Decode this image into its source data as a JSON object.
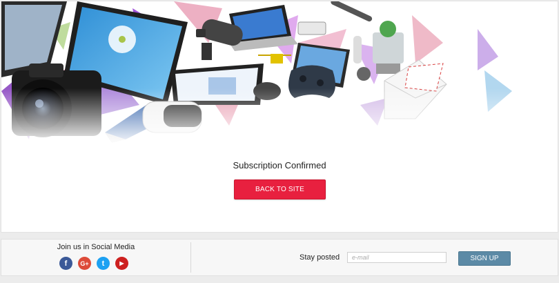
{
  "main": {
    "confirmation_text": "Subscription Confirmed",
    "back_button_label": "BACK TO SITE",
    "accent_color": "#e8203f"
  },
  "footer": {
    "social_title": "Join us in Social Media",
    "social_icons": [
      {
        "name": "facebook-icon",
        "glyph": "f",
        "color": "#3b5998"
      },
      {
        "name": "google-plus-icon",
        "glyph": "G+",
        "color": "#dd4b39"
      },
      {
        "name": "twitter-icon",
        "glyph": "t",
        "color": "#1da1f2"
      },
      {
        "name": "youtube-icon",
        "glyph": "▶",
        "color": "#cd201f"
      }
    ],
    "stay_posted_label": "Stay posted",
    "email_placeholder": "e-mail",
    "signup_label": "SIGN UP",
    "signup_color": "#5c8aa6"
  }
}
